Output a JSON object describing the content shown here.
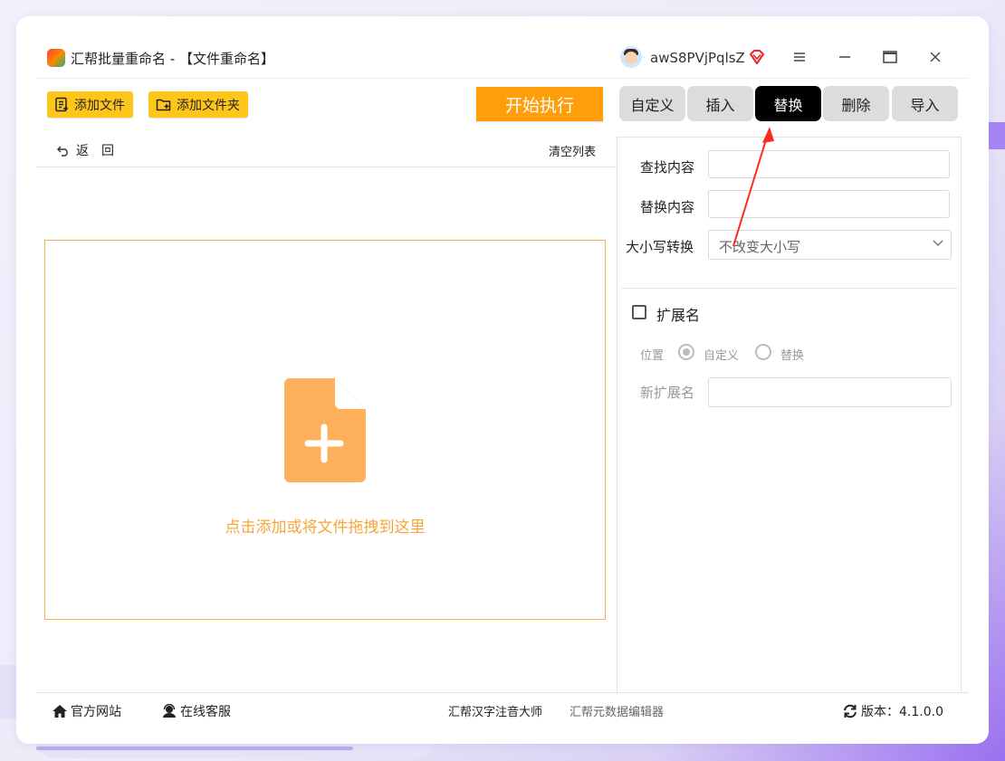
{
  "window": {
    "title": "汇帮批量重命名 - 【文件重命名】",
    "username": "awS8PVjPqlsZ",
    "controls": [
      "menu-icon",
      "minimize-icon",
      "maximize-icon",
      "close-icon"
    ]
  },
  "toolbar": {
    "add_file": "添加文件",
    "add_folder": "添加文件夹",
    "start": "开始执行"
  },
  "tabs": [
    {
      "label": "自定义",
      "active": false
    },
    {
      "label": "插入",
      "active": false
    },
    {
      "label": "替换",
      "active": true
    },
    {
      "label": "删除",
      "active": false
    },
    {
      "label": "导入",
      "active": false
    }
  ],
  "file_list": {
    "back_label": "返回",
    "clear_label": "清空列表",
    "drop_hint": "点击添加或将文件拖拽到这里"
  },
  "replace_form": {
    "find_label": "查找内容",
    "find_value": "",
    "replace_label": "替换内容",
    "replace_value": "",
    "case_label": "大小写转换",
    "case_value": "不改变大小写"
  },
  "extension": {
    "label": "扩展名",
    "checked": false,
    "position_label": "位置",
    "option_custom": "自定义",
    "option_replace": "替换",
    "selected_option": "自定义",
    "new_ext_label": "新扩展名",
    "new_ext_value": ""
  },
  "statusbar": {
    "website": "官方网站",
    "support": "在线客服",
    "link1": "汇帮汉字注音大师",
    "link2": "汇帮元数据编辑器",
    "version": "版本：4.1.0.0"
  },
  "colors": {
    "accent_yellow": "#ffc61a",
    "start_orange": "#ff9d0a",
    "drop_border": "#f0b44a",
    "drop_text": "#f4a63a",
    "active_tab": "#000000",
    "annotation_arrow": "#ff2a1f"
  }
}
